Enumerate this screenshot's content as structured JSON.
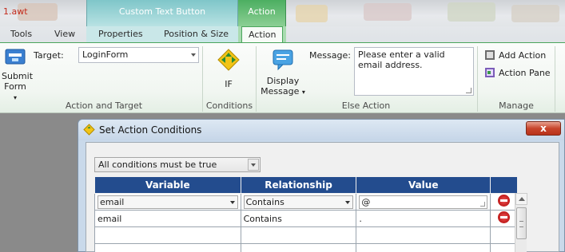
{
  "window": {
    "doc_title": "1.awt"
  },
  "context_tabs": {
    "group_label": "Custom Text Button",
    "action_group_label": "Action"
  },
  "tabs": [
    {
      "label": "Tools"
    },
    {
      "label": "View"
    },
    {
      "label": "Properties"
    },
    {
      "label": "Position & Size"
    },
    {
      "label": "Action"
    }
  ],
  "ribbon": {
    "action_target": {
      "submit_form_label_1": "Submit",
      "submit_form_label_2": "Form",
      "target_label": "Target:",
      "target_value": "LoginForm",
      "group_label": "Action and Target"
    },
    "conditions": {
      "if_label": "IF",
      "group_label": "Conditions"
    },
    "else_action": {
      "display_message_1": "Display",
      "display_message_2": "Message",
      "message_label": "Message:",
      "message_value": "Please enter a valid email address.",
      "group_label": "Else Action"
    },
    "manage": {
      "add_action": "Add Action",
      "action_pane": "Action Pane",
      "group_label": "Manage"
    }
  },
  "dialog": {
    "title": "Set Action Conditions",
    "close_label": "x",
    "condition_mode": "All conditions must be true",
    "columns": [
      "Variable",
      "Relationship",
      "Value"
    ],
    "rows": [
      {
        "variable": "email",
        "relationship": "Contains",
        "value": "@"
      },
      {
        "variable": "email",
        "relationship": "Contains",
        "value": "."
      }
    ]
  },
  "colors": {
    "grid_header": "#234c8e",
    "action_tab": "#4aa55c",
    "context_tab": "#7fc6c9"
  }
}
